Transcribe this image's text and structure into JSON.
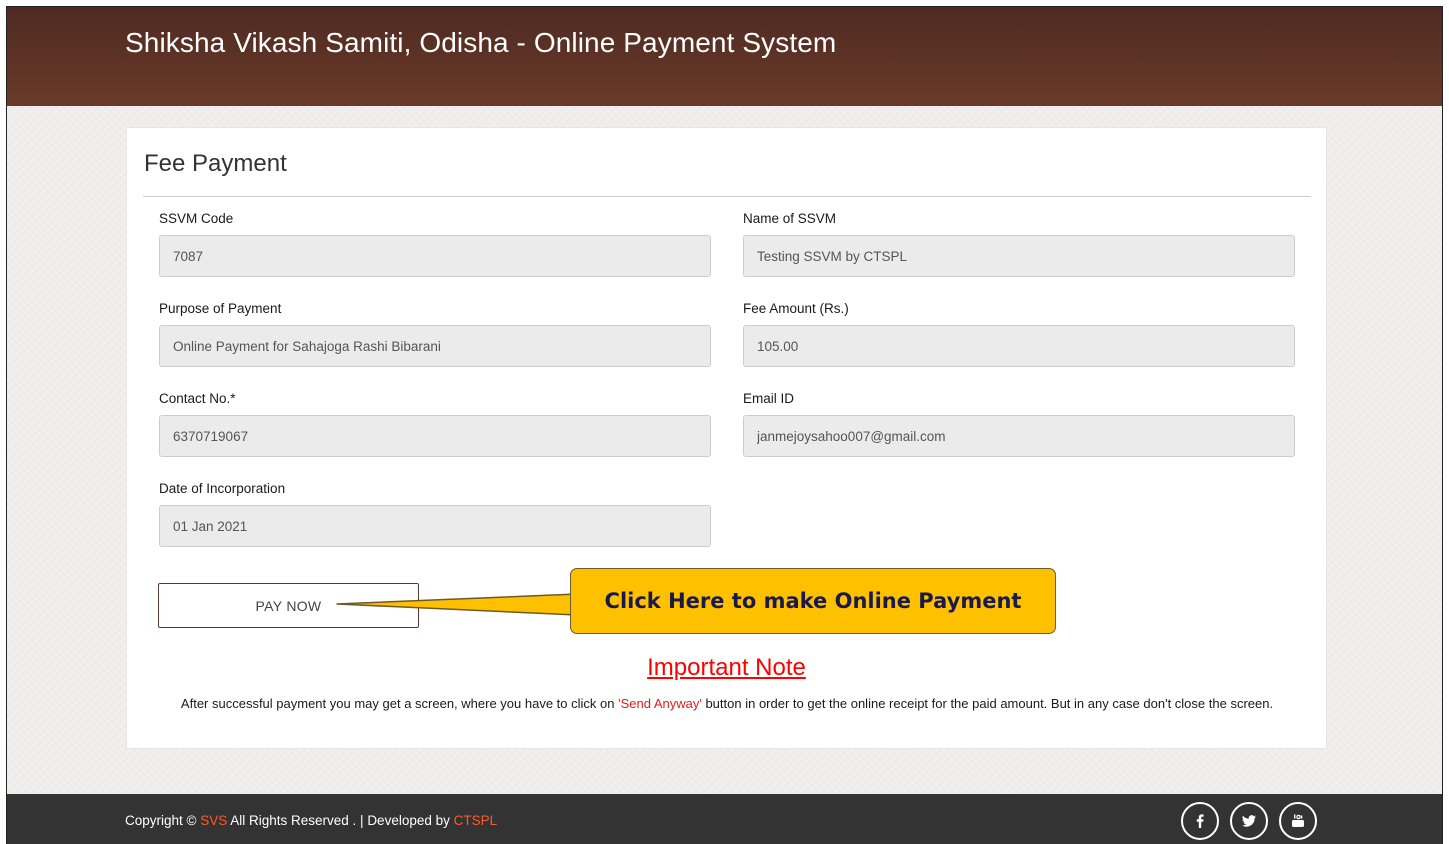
{
  "header": {
    "title": "Shiksha Vikash Samiti, Odisha - Online Payment System"
  },
  "form": {
    "title": "Fee Payment",
    "fields": [
      {
        "label": "SSVM Code",
        "value": "7087"
      },
      {
        "label": "Name of SSVM",
        "value": "Testing SSVM by CTSPL"
      },
      {
        "label": "Purpose of Payment",
        "value": "Online Payment for Sahajoga Rashi Bibarani"
      },
      {
        "label": "Fee Amount (Rs.)",
        "value": "105.00"
      },
      {
        "label": "Contact No.*",
        "value": "6370719067"
      },
      {
        "label": "Email ID",
        "value": "janmejoysahoo007@gmail.com"
      },
      {
        "label": "Date of Incorporation",
        "value": "01 Jan 2021"
      }
    ],
    "pay_button": "PAY NOW"
  },
  "callout": {
    "text": "Click Here to make Online Payment",
    "color": "#ffc000"
  },
  "note": {
    "title": "Important Note",
    "text_before": "After successful payment you may get a screen, where you have to click on ",
    "highlight": "'Send Anyway'",
    "text_after": " button in order to get the online receipt for the paid amount. But in any case don't close the screen."
  },
  "footer": {
    "copyright_prefix": "Copyright © ",
    "brand": "SVS",
    "rights": " All Rights Reserved . | Developed by ",
    "developer": "CTSPL",
    "social_icons": [
      "facebook-icon",
      "twitter-icon",
      "youtube-icon"
    ]
  }
}
